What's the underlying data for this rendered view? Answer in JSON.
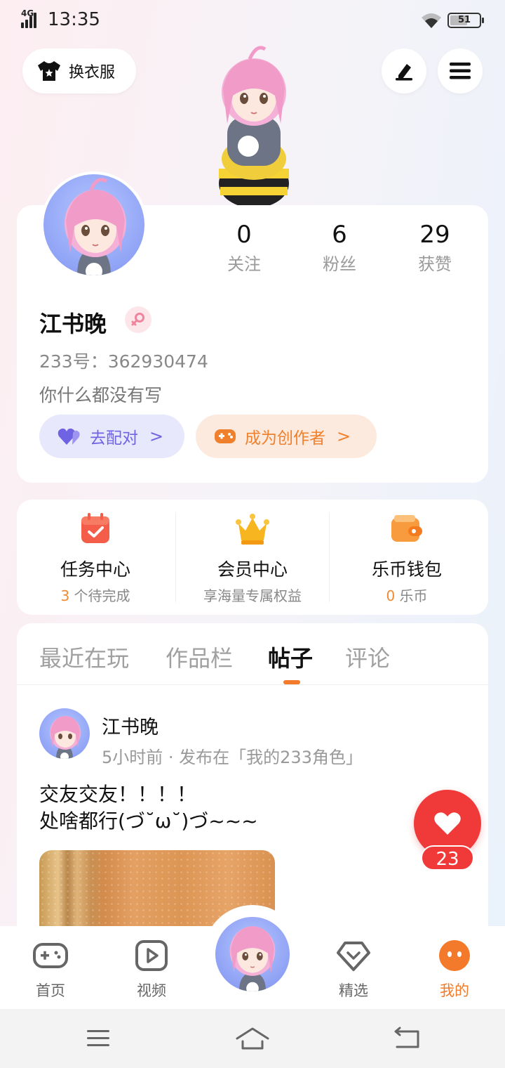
{
  "status_bar": {
    "network": "4G",
    "time": "13:35",
    "battery": "51"
  },
  "top_bar": {
    "outfit_label": "换衣服"
  },
  "profile": {
    "stats": [
      {
        "value": "0",
        "label": "关注"
      },
      {
        "value": "6",
        "label": "粉丝"
      },
      {
        "value": "29",
        "label": "获赞"
      }
    ],
    "name": "江书晚",
    "uid": "233号：362930474",
    "bio": "你什么都没有写",
    "match_label": "去配对",
    "creator_label": "成为创作者",
    "chevron": ">"
  },
  "services": [
    {
      "title": "任务中心",
      "count": "3",
      "sub": " 个待完成"
    },
    {
      "title": "会员中心",
      "count": "",
      "sub": "享海量专属权益"
    },
    {
      "title": "乐币钱包",
      "count": "0",
      "sub": " 乐币"
    }
  ],
  "tabs": [
    "最近在玩",
    "作品栏",
    "帖子",
    "评论"
  ],
  "active_tab": "帖子",
  "post": {
    "author": "江书晚",
    "meta": "5小时前 · 发布在「我的233角色」",
    "line1": "交友交友！！！！",
    "line2": "处啥都行(づ˘ω˘)づ~~~",
    "like_count": "23"
  },
  "bottom_nav": [
    {
      "label": "首页",
      "icon": "gamepad-icon"
    },
    {
      "label": "视频",
      "icon": "video-play-icon"
    },
    {
      "label": "精选",
      "icon": "heart-diamond-icon"
    },
    {
      "label": "我的",
      "icon": "face-icon"
    }
  ],
  "colors": {
    "accent_orange": "#f27a2a",
    "match_purple": "#6f63e3",
    "like_red": "#f03a3a"
  }
}
